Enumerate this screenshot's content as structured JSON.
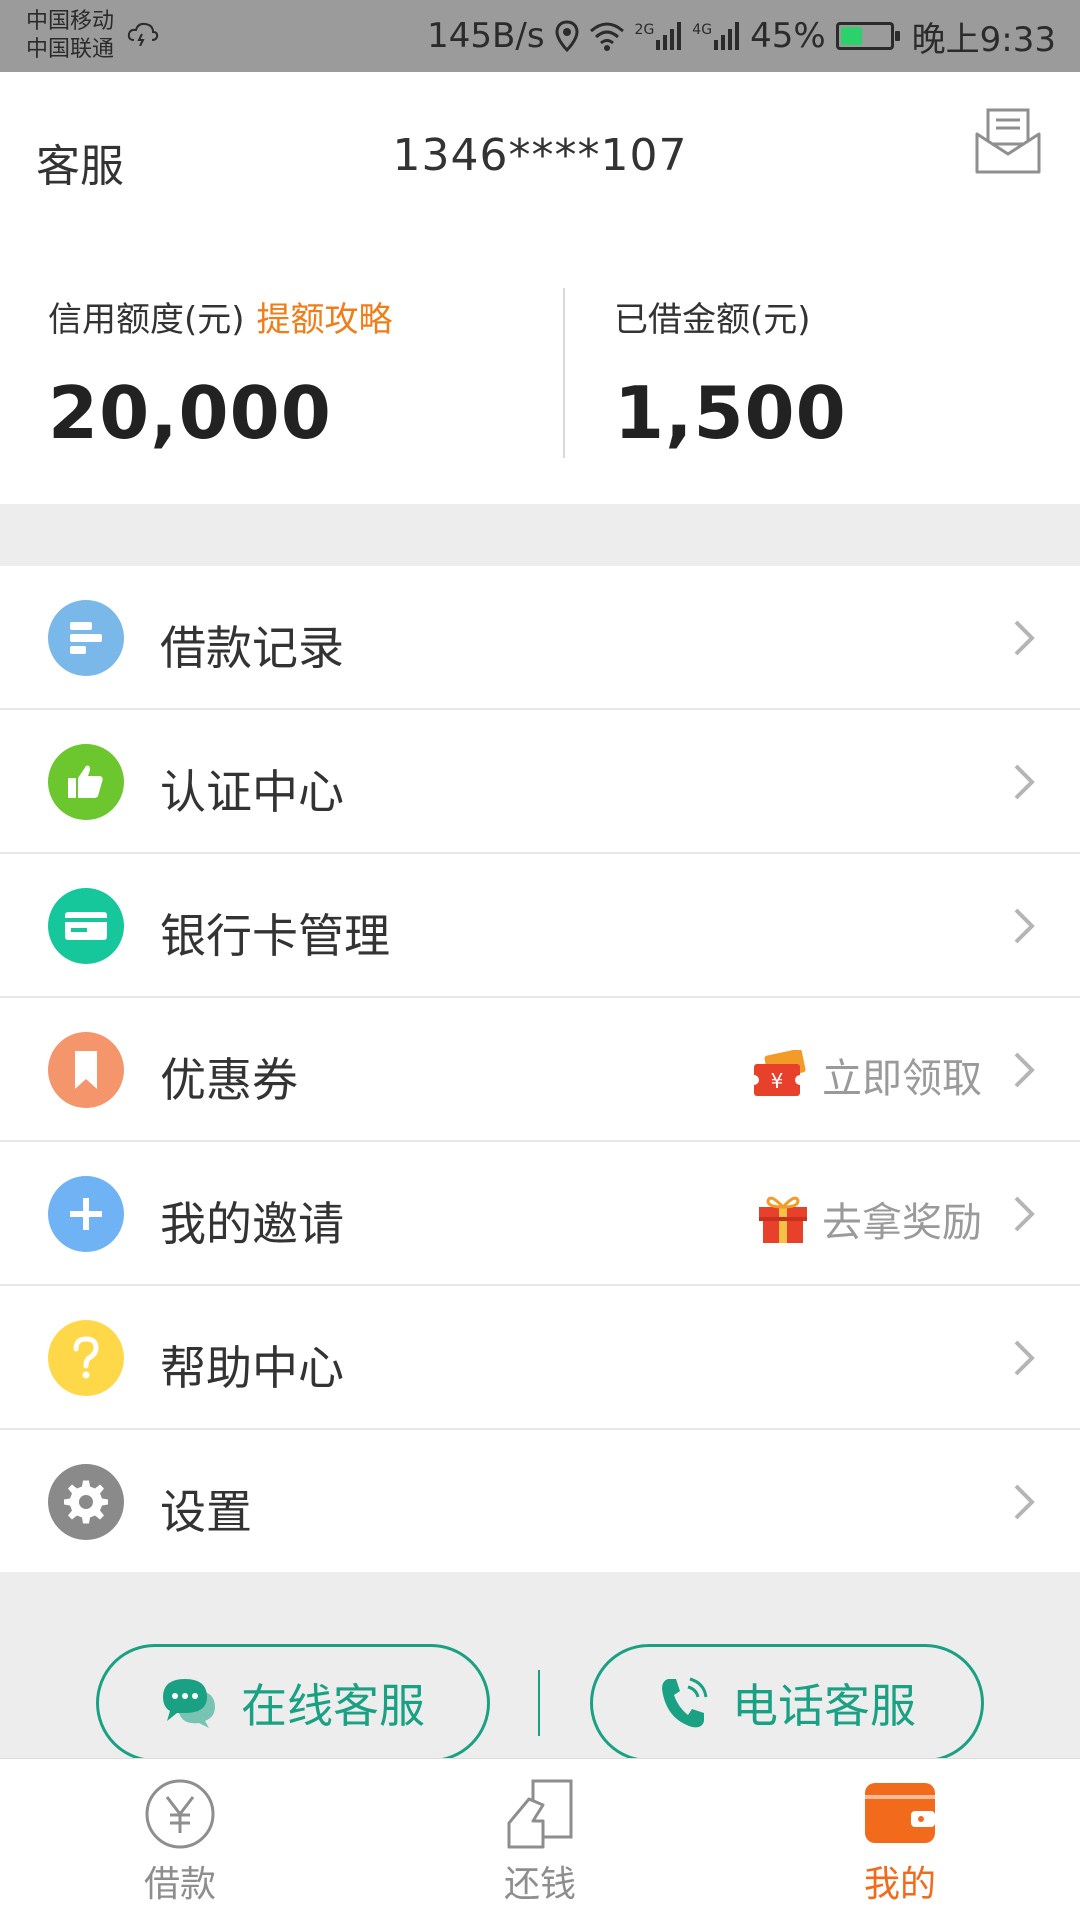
{
  "status_bar": {
    "carrier_1": "中国移动",
    "carrier_2": "中国联通",
    "speed": "145B/s",
    "signal_1": "2G",
    "signal_2": "4G",
    "battery": "45%",
    "time": "晚上9:33",
    "battery_level": 0.45
  },
  "header": {
    "left_label": "客服",
    "phone": "1346****107",
    "message_icon": "envelope-icon"
  },
  "credit": {
    "limit_label": "信用额度(元)",
    "limit_link": "提额攻略",
    "limit_value": "20,000",
    "borrowed_label": "已借金额(元)",
    "borrowed_value": "1,500"
  },
  "menu": {
    "items": [
      {
        "label": "借款记录",
        "icon": "list-icon",
        "color": "#79b8e8"
      },
      {
        "label": "认证中心",
        "icon": "thumbs-up-icon",
        "color": "#6cc62d"
      },
      {
        "label": "银行卡管理",
        "icon": "card-icon",
        "color": "#16c79b"
      },
      {
        "label": "优惠券",
        "icon": "bookmark-icon",
        "color": "#f4956b",
        "extra": "立即领取",
        "extra_icon": "coupon-icon"
      },
      {
        "label": "我的邀请",
        "icon": "plus-icon",
        "color": "#6fb3f5",
        "extra": "去拿奖励",
        "extra_icon": "gift-icon"
      },
      {
        "label": "帮助中心",
        "icon": "question-icon",
        "color": "#ffd84a"
      },
      {
        "label": "设置",
        "icon": "gear-icon",
        "color": "#8a8a8a"
      }
    ]
  },
  "support": {
    "online": "在线客服",
    "phone": "电话客服",
    "accent": "#1aa184"
  },
  "tabs": {
    "items": [
      {
        "label": "借款",
        "icon": "yen-icon"
      },
      {
        "label": "还钱",
        "icon": "repay-icon"
      },
      {
        "label": "我的",
        "icon": "wallet-icon",
        "active": true
      }
    ],
    "active_color": "#f26a1b"
  }
}
